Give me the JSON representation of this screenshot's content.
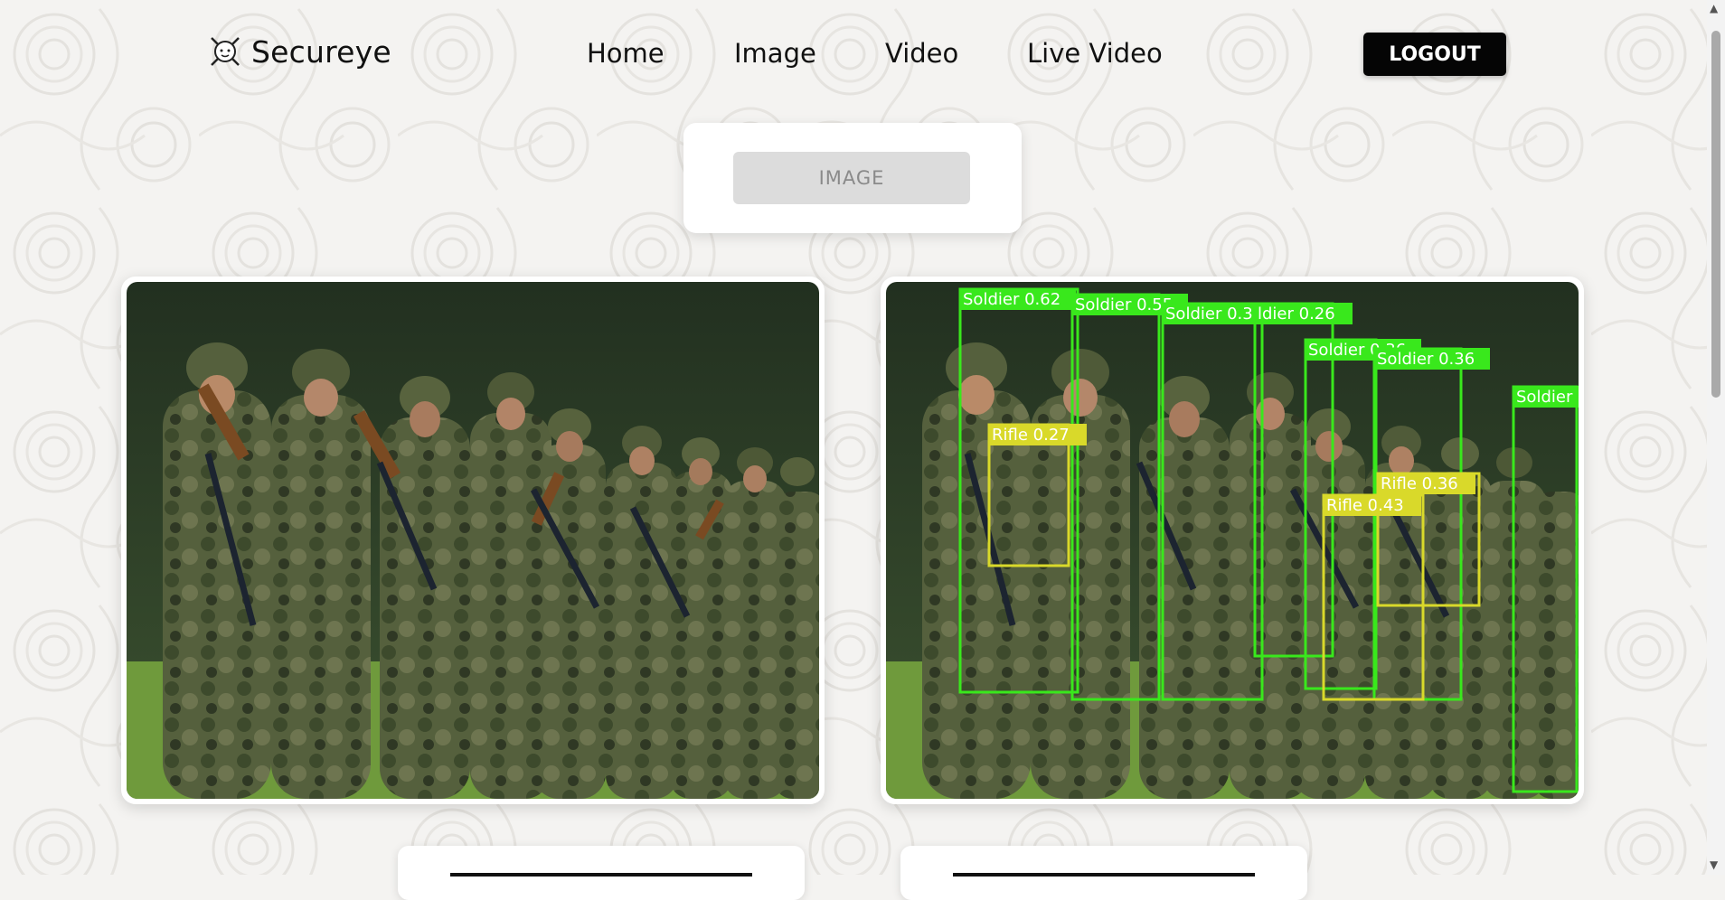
{
  "brand": {
    "name": "Secureye",
    "logo_icon": "shield-crossed-swords-icon"
  },
  "nav": {
    "links": [
      "Home",
      "Image",
      "Video",
      "Live Video"
    ],
    "logout_label": "LOGOUT"
  },
  "upload": {
    "button_label": "IMAGE"
  },
  "colors": {
    "soldier_box": "#39e81c",
    "rifle_box": "#d9d92a",
    "logout_bg": "#050505"
  },
  "detections": [
    {
      "label": "Soldier 0.62"
    },
    {
      "label": "Soldier 0.55"
    },
    {
      "label": "Soldier 0.32"
    },
    {
      "label": "ldier 0.26"
    },
    {
      "label": "Soldier 0.36"
    },
    {
      "label": "Soldier 0.36"
    },
    {
      "label": "Soldier"
    },
    {
      "label": "Rifle 0.27"
    },
    {
      "label": "Rifle 0.43"
    },
    {
      "label": "Rifle 0.36"
    }
  ]
}
